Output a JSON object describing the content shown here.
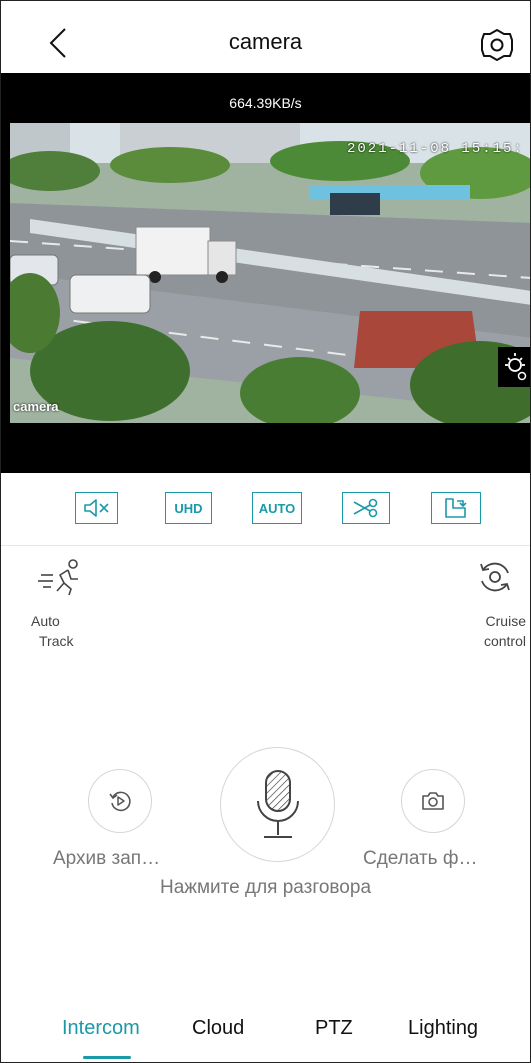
{
  "header": {
    "title": "camera"
  },
  "video": {
    "bitrate": "664.39KB/s",
    "timestamp": "2021-11-08 15:15:",
    "camera_label": "camera"
  },
  "toolbar": {
    "quality_label": "UHD",
    "mode_label": "AUTO"
  },
  "features": {
    "auto_track_line1": "Auto",
    "auto_track_line2": "Track",
    "cruise_line1": "Cruise",
    "cruise_line2": "control"
  },
  "controls": {
    "archive_label": "Архив зап…",
    "snapshot_label": "Сделать ф…",
    "talk_hint": "Нажмите для разговора"
  },
  "tabs": [
    {
      "label": "Intercom",
      "active": true
    },
    {
      "label": "Cloud",
      "active": false
    },
    {
      "label": "PTZ",
      "active": false
    },
    {
      "label": "Lighting",
      "active": false
    }
  ],
  "colors": {
    "accent": "#1a9aa8",
    "background": "#ffffff",
    "video_bg": "#000000"
  },
  "icons": [
    "back-icon",
    "settings-gear-icon",
    "light-settings-icon",
    "mute-icon",
    "scissors-icon",
    "screen-rotate-icon",
    "running-person-icon",
    "cruise-rotate-icon",
    "replay-icon",
    "microphone-icon",
    "camera-icon"
  ]
}
